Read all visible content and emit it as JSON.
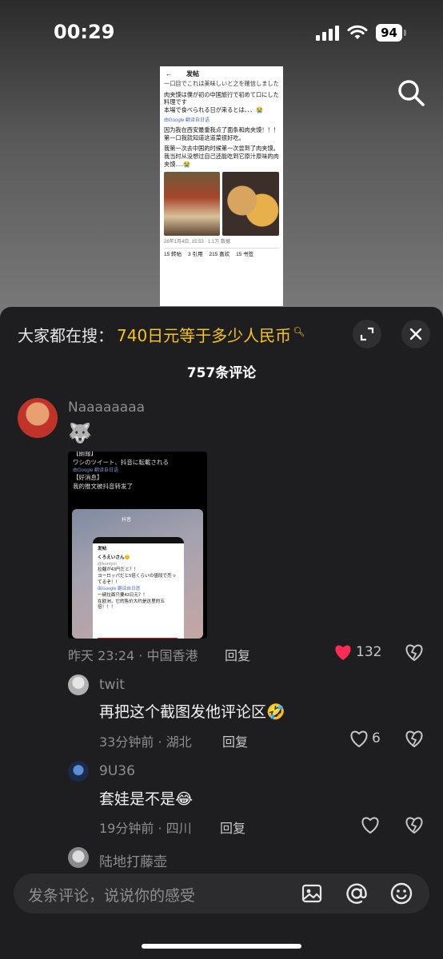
{
  "status_bar": {
    "time": "00:29",
    "battery": "94"
  },
  "preview": {
    "header": "发帖",
    "lines": [
      "一口目でこれは美味しいと之を確信しました",
      "肉夹馍は僕が初の中国旅行で初めて口にした料理です\n本場で食べられる日が来るとは、、、😭",
      "由Google 翻译自日语",
      "因为我在西安最重我点了面条和肉夹馍！！！\n第一口我就知道这道菜很好吃。",
      "我第一次去中国的时候第一次尝到了肉夹馍。我当时从没想过自己还能吃到它原汁原味的肉夹馍.....😭"
    ],
    "meta": "26年1月4日, 15:53 · 1.1万 数据",
    "stats": [
      "15 转帖",
      "3 引用",
      "215 喜欢",
      "15 书签"
    ]
  },
  "panel": {
    "search_label": "大家都在搜：",
    "search_query": "740日元等于多少人民币",
    "comment_count": "757条评论"
  },
  "comments": [
    {
      "user": "Naaaaaaaa",
      "emoji": "🐺",
      "image": {
        "lines": [
          "【朗報】",
          "ワシのツイート、抖音に転載される",
          "由Google 翻译自日语",
          "【好消息】",
          "我的推文被抖音转发了"
        ],
        "app_label": "抖音",
        "card_header": "发帖",
        "card_user": "くろえいさん😊",
        "card_handle": "@kuroyei",
        "card_lines": [
          "拉麺が43円だと？！",
          "ヨーロッパだと5倍くらいの値段で売ってるぞ！！",
          "由Google 翻译自日语",
          "一碗拉面只要43日元？！",
          "在欧洲，它的售价大约是这里的五倍！！！"
        ]
      },
      "time": "昨天 23:24 · 中国香港",
      "reply": "回复",
      "likes": "132"
    },
    {
      "user": "twit",
      "text": "再把这个截图发他评论区🤣",
      "time": "33分钟前 · 湖北",
      "reply": "回复",
      "likes": "6"
    },
    {
      "user": "9U36",
      "text": "套娃是不是😂",
      "time": "19分钟前 · 四川",
      "reply": "回复",
      "likes": ""
    },
    {
      "user": "陆地打藤壶"
    }
  ],
  "input": {
    "placeholder": "发条评论，说说你的感受"
  },
  "colors": {
    "accent_like": "#fe2c55",
    "query_yellow": "#f5c518",
    "panel_bg": "#1e1e20"
  }
}
